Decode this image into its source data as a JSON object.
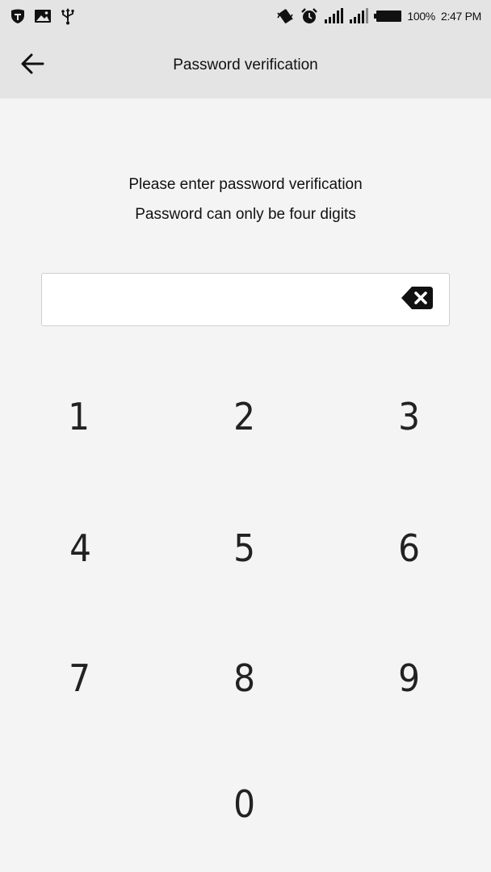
{
  "status_bar": {
    "battery_percent": "100%",
    "time": "2:47 PM",
    "icons_left": [
      "shield-app-icon",
      "image-notification-icon",
      "usb-icon"
    ],
    "icons_right": [
      "vibrate-icon",
      "alarm-icon",
      "signal-icon",
      "signal-icon-2",
      "battery-icon"
    ]
  },
  "app_bar": {
    "back_icon": "arrow-left-icon",
    "title": "Password verification"
  },
  "instructions": {
    "line1": "Please enter password verification",
    "line2": "Password can only be four digits"
  },
  "password_field": {
    "value": "",
    "clear_icon": "backspace-clear-icon"
  },
  "keypad": {
    "keys": [
      "1",
      "2",
      "3",
      "4",
      "5",
      "6",
      "7",
      "8",
      "9",
      "0"
    ]
  }
}
